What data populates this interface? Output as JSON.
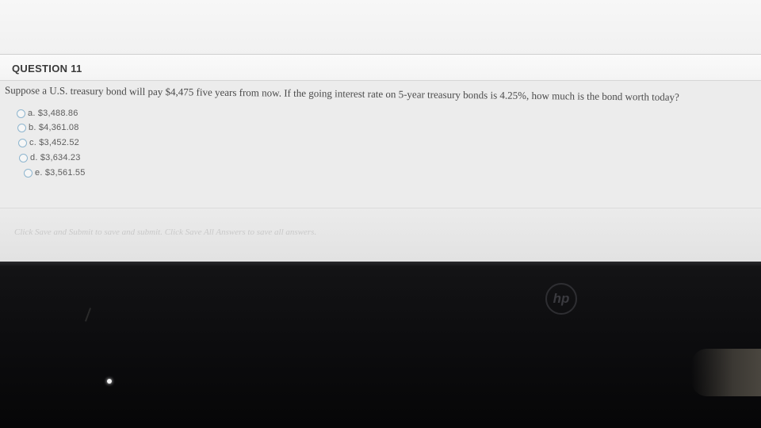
{
  "question": {
    "title": "QUESTION 11",
    "text": "Suppose a U.S. treasury bond will pay $4,475 five years from now. If the going interest rate on 5-year treasury bonds is 4.25%, how much is the bond worth today?",
    "options": [
      {
        "label": "a. $3,488.86"
      },
      {
        "label": "b. $4,361.08"
      },
      {
        "label": "c. $3,452.52"
      },
      {
        "label": "d. $3,634.23"
      },
      {
        "label": "e. $3,561.55"
      }
    ]
  },
  "footer": {
    "save_instructions": "Click Save and Submit to save and submit. Click Save All Answers to save all answers."
  },
  "monitor": {
    "logo_text": "hp"
  },
  "colors": {
    "screen_bg": "#ececec",
    "bezel": "#0d0d0f",
    "radio_border": "#8fb6cf",
    "text": "#4a4a4a"
  }
}
